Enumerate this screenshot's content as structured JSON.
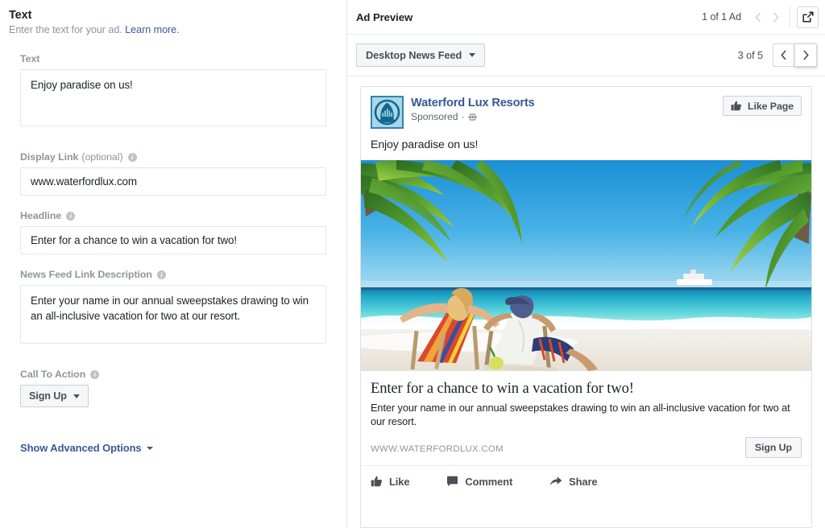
{
  "left": {
    "section_title": "Text",
    "section_sub_text": "Enter the text for your ad.",
    "learn_more": "Learn more.",
    "fields": {
      "text": {
        "label": "Text",
        "value": "Enjoy paradise on us!"
      },
      "display_link": {
        "label": "Display Link",
        "optional": "(optional)",
        "value": "www.waterfordlux.com"
      },
      "headline": {
        "label": "Headline",
        "value": "Enter for a chance to win a vacation for two!"
      },
      "news_feed_link_description": {
        "label": "News Feed Link Description",
        "value": "Enter your name in our annual sweepstakes drawing to win an all-inclusive vacation for two at our resort."
      },
      "call_to_action": {
        "label": "Call To Action",
        "value": "Sign Up"
      }
    },
    "advanced_options": "Show Advanced Options"
  },
  "preview": {
    "title": "Ad Preview",
    "ad_count": "1 of 1 Ad",
    "prev_icon": "chevron-left-icon",
    "next_icon": "chevron-right-icon",
    "expand_icon": "external-link-icon",
    "placement": "Desktop News Feed",
    "placement_count": "3 of 5",
    "nav_prev": "‹",
    "nav_next": "›"
  },
  "ad": {
    "page_name": "Waterford Lux Resorts",
    "sponsored": "Sponsored",
    "sponsored_separator": "·",
    "globe_icon": "globe-icon",
    "like_page": "Like Page",
    "like_page_icon": "thumbs-up-icon",
    "message": "Enjoy paradise on us!",
    "image_alt": "beach-scene-couple-lounge-chairs",
    "headline": "Enter for a chance to win a vacation for two!",
    "description": "Enter your name in our annual sweepstakes drawing to win an all-inclusive vacation for two at our resort.",
    "domain": "WWW.WATERFORDLUX.COM",
    "cta_button": "Sign Up",
    "actions": [
      {
        "label": "Like",
        "icon": "thumbs-up-icon"
      },
      {
        "label": "Comment",
        "icon": "comment-bubble-icon"
      },
      {
        "label": "Share",
        "icon": "share-arrow-icon"
      }
    ]
  },
  "colors": {
    "link_blue": "#3b5998",
    "page_name_blue": "#365899",
    "label_gray": "#90949c",
    "text_dark": "#1d2129",
    "border": "#dddfe2",
    "button_bg": "#f6f7f9",
    "avatar_teal": "#2f86a8"
  }
}
